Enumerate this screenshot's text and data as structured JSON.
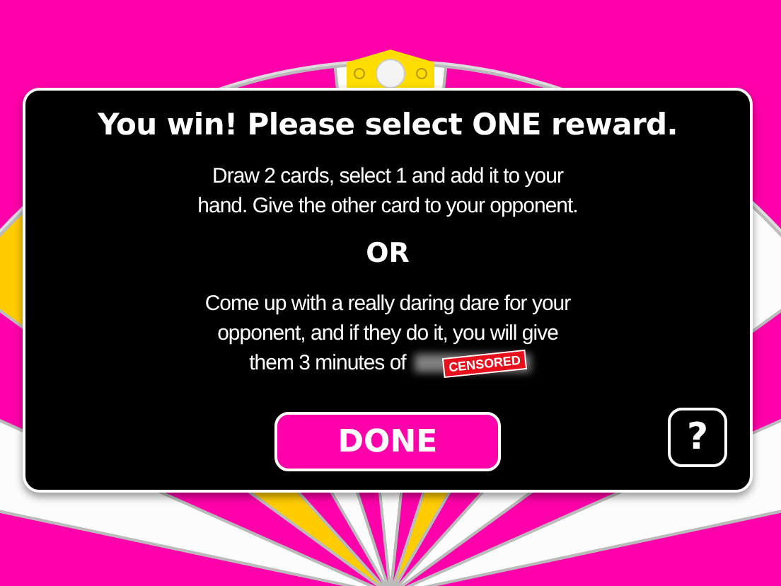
{
  "dialog": {
    "title": "You win! Please select ONE reward.",
    "options": [
      {
        "text": "Draw 2 cards, select 1 and add it to your hand. Give the other card to your opponent."
      },
      {
        "text": "Come up with a really daring dare for your opponent, and if they do it, you will give",
        "text_end": "them 3 minutes of",
        "censor_label": "CENSORED"
      }
    ],
    "separator": "OR",
    "done_button": "DONE",
    "help_button": "?"
  }
}
